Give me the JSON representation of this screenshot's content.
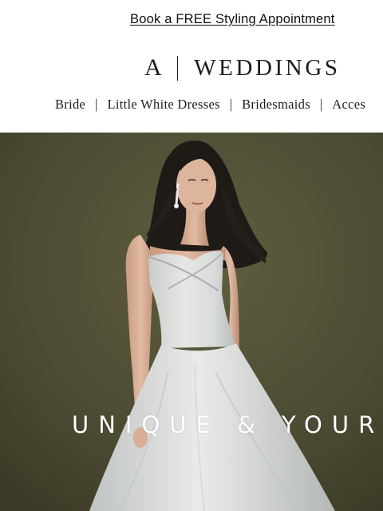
{
  "promo": {
    "link_text": "Book a FREE Styling Appointment"
  },
  "logo": {
    "mark": "A",
    "wordmark": "WEDDINGS"
  },
  "nav": {
    "items": [
      {
        "label": "Bride"
      },
      {
        "label": "Little White Dresses"
      },
      {
        "label": "Bridesmaids"
      },
      {
        "label": "Acces"
      }
    ],
    "separator": "|"
  },
  "hero": {
    "headline": "UNIQUE & YOUR",
    "image_alt_icon": "bride-photo"
  },
  "colors": {
    "background": "#ffffff",
    "text": "#1d1d1d",
    "hero_backdrop": "#4f4e34",
    "headline": "#ffffff"
  }
}
